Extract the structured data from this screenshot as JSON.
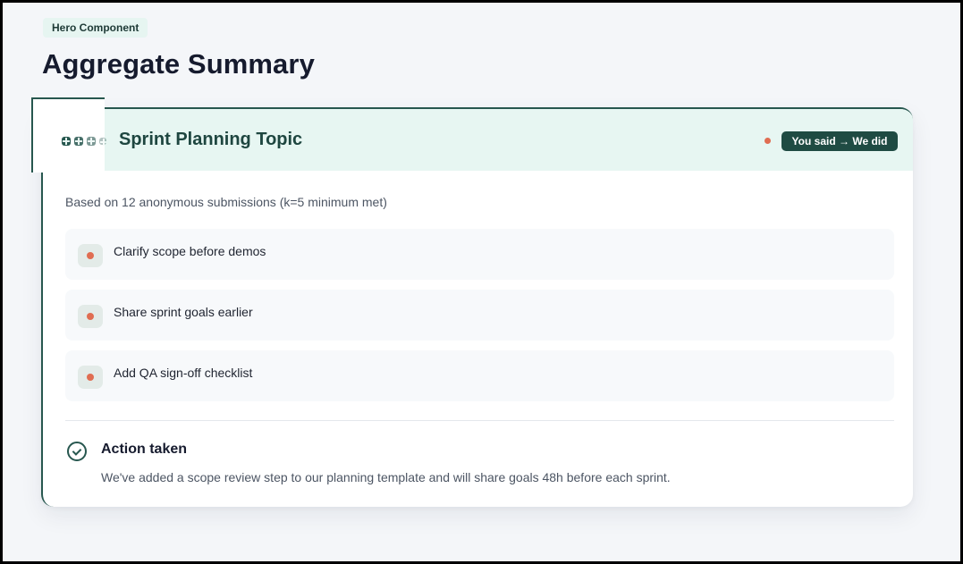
{
  "header": {
    "tag": "Hero Component",
    "title": "Aggregate Summary"
  },
  "card": {
    "topic_title": "Sprint Planning Topic",
    "badge": "You said → We did",
    "submissions_note": "Based on 12 anonymous submissions (k=5 minimum met)",
    "items": [
      {
        "label": "Clarify scope before demos"
      },
      {
        "label": "Share sprint goals earlier"
      },
      {
        "label": "Add QA sign-off checklist"
      }
    ],
    "action": {
      "title": "Action taken",
      "description": "We've added a scope review step to our planning template and will share goals 48h before each sprint."
    }
  },
  "colors": {
    "accent": "#27574f",
    "header_bg": "#e7f6f2",
    "bullet": "#e06d52"
  }
}
